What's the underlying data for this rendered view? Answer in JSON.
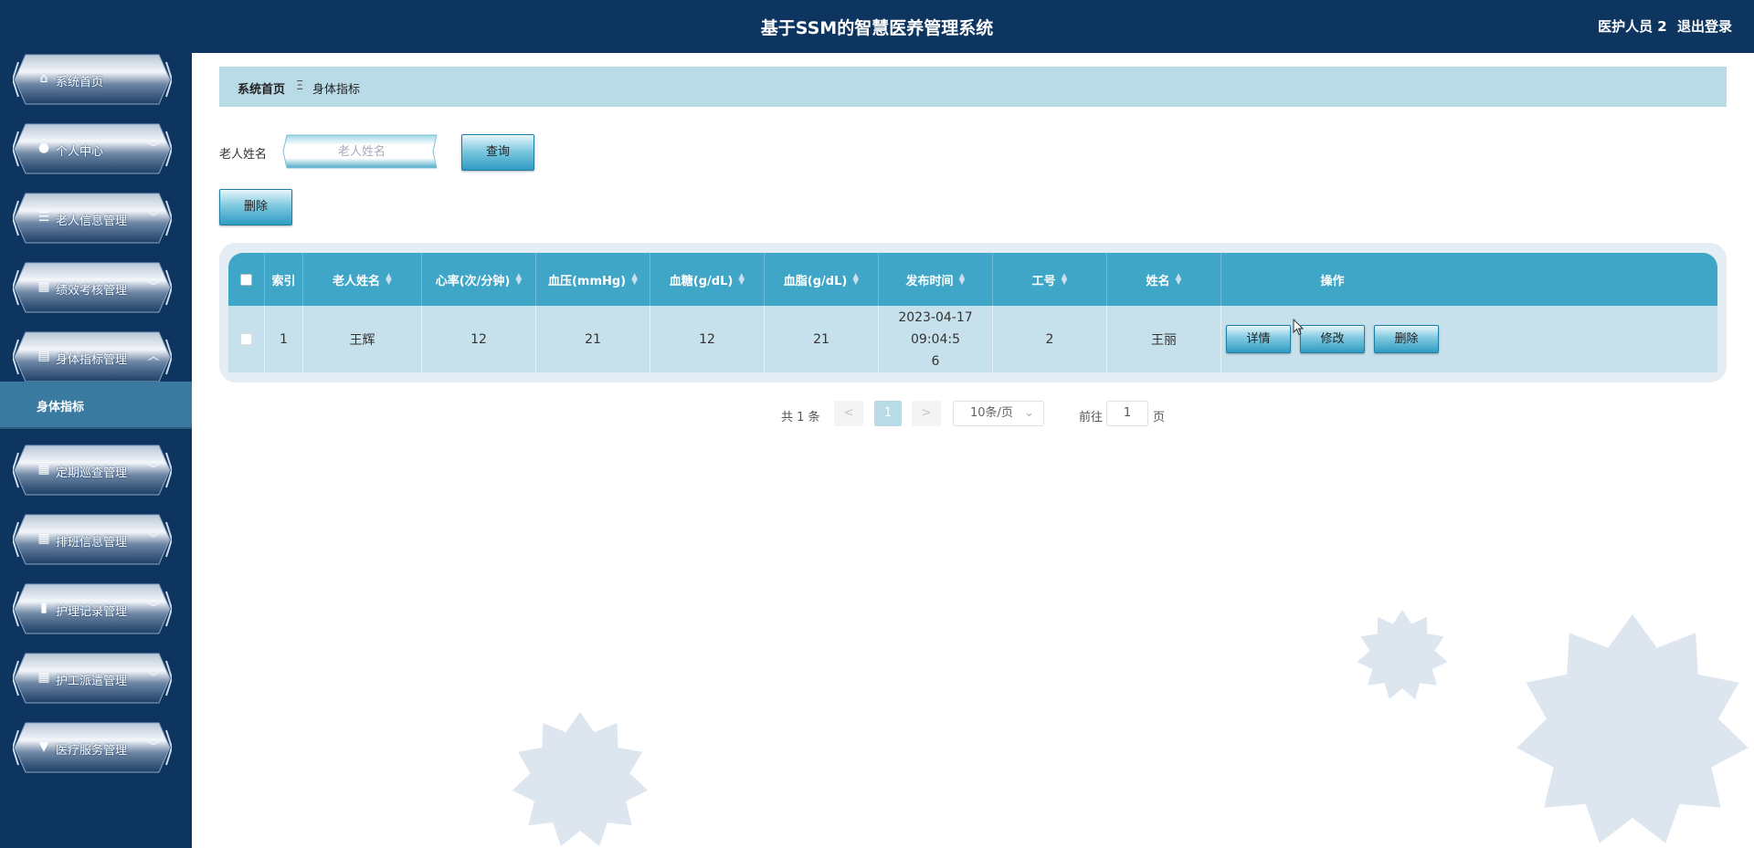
{
  "header": {
    "title": "基于SSM的智慧医养管理系统",
    "user": "医护人员 2",
    "logout": "退出登录"
  },
  "sidebar": {
    "items": [
      {
        "label": "系统首页",
        "icon": "home-icon"
      },
      {
        "label": "个人中心",
        "icon": "person-icon"
      },
      {
        "label": "老人信息管理",
        "icon": "list-icon"
      },
      {
        "label": "绩效考核管理",
        "icon": "grid-icon"
      },
      {
        "label": "身体指标管理",
        "icon": "clipboard-icon"
      },
      {
        "label": "定期巡查管理",
        "icon": "grid-icon"
      },
      {
        "label": "排班信息管理",
        "icon": "grid-icon"
      },
      {
        "label": "护理记录管理",
        "icon": "bar-chart-icon"
      },
      {
        "label": "护工派遣管理",
        "icon": "grid-icon"
      },
      {
        "label": "医疗服务管理",
        "icon": "stamp-icon"
      }
    ],
    "active_sub": "身体指标"
  },
  "breadcrumb": {
    "home": "系统首页",
    "separator": "Ξ",
    "current": "身体指标"
  },
  "search": {
    "label": "老人姓名",
    "placeholder": "老人姓名",
    "value": "",
    "query_button": "查询"
  },
  "actions": {
    "delete_button": "删除"
  },
  "table": {
    "headers": [
      "索引",
      "老人姓名",
      "心率(次/分钟)",
      "血压(mmHg)",
      "血糖(g/dL)",
      "血脂(g/dL)",
      "发布时间",
      "工号",
      "姓名",
      "操作"
    ],
    "rows": [
      {
        "index": "1",
        "name": "王辉",
        "heart_rate": "12",
        "blood_pressure": "21",
        "blood_sugar": "12",
        "blood_lipid": "21",
        "time_line1": "2023-04-17 09:04:5",
        "time_line2": "6",
        "staff_id": "2",
        "staff_name": "王丽",
        "op_detail": "详情",
        "op_edit": "修改",
        "op_delete": "删除"
      }
    ]
  },
  "pagination": {
    "total": "共 1 条",
    "prev": "<",
    "page": "1",
    "next": ">",
    "page_size": "10条/页",
    "goto": "前往",
    "goto_value": "1",
    "unit": "页"
  },
  "colors": {
    "topbar": "#0e3560",
    "accent": "#3fa6c8",
    "breadcrumb_bg": "#b8dbe6"
  }
}
